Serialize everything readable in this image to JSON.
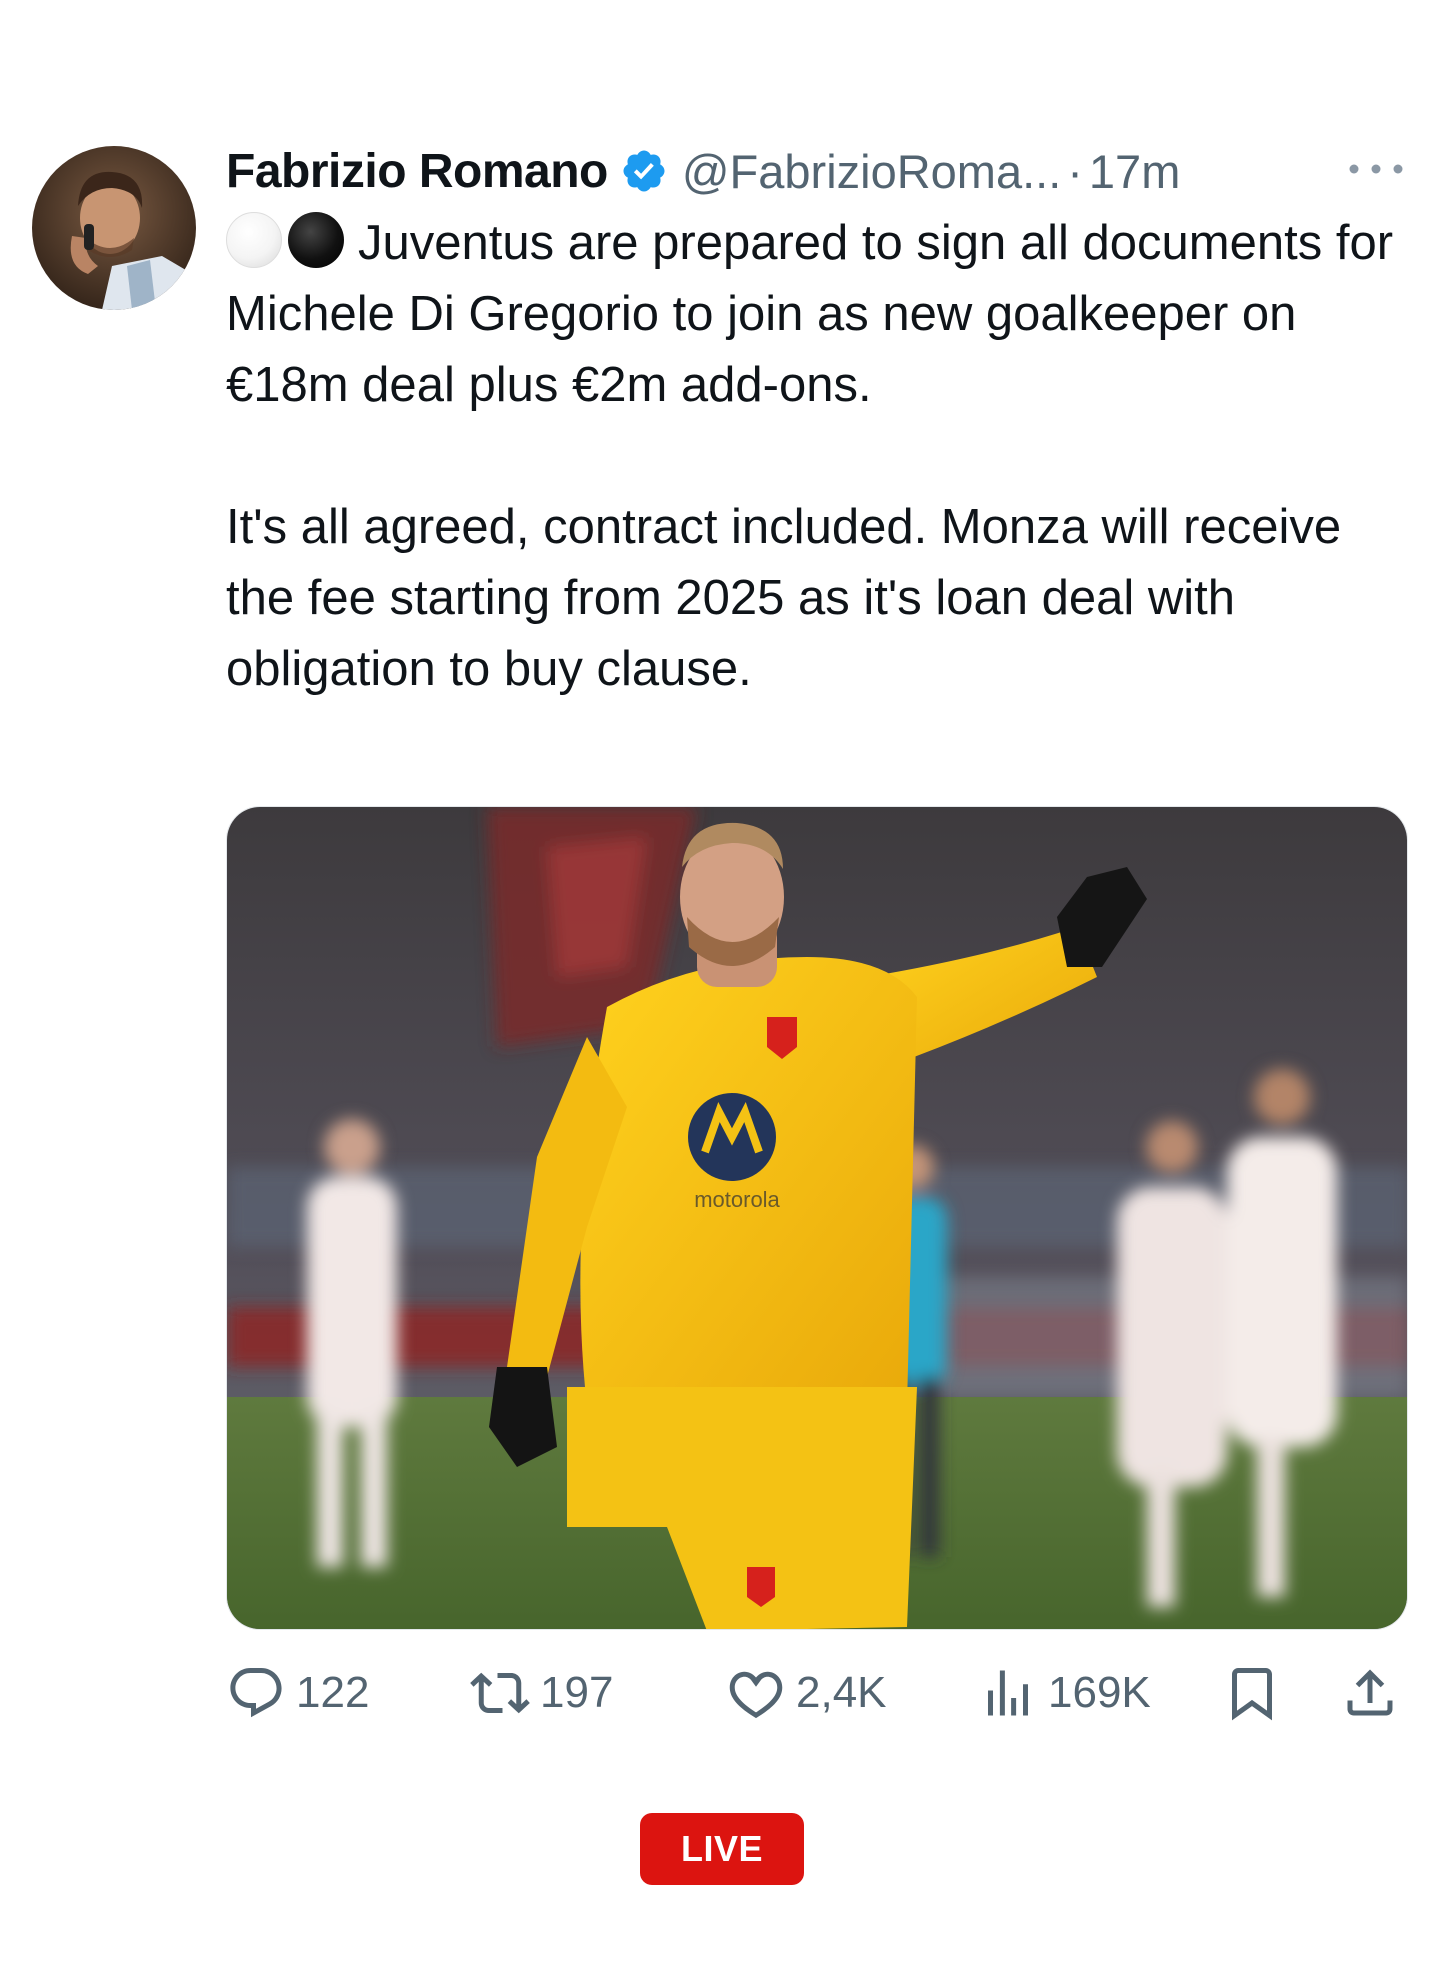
{
  "author": {
    "display_name": "Fabrizio Romano",
    "handle": "@FabrizioRoma...",
    "separator": "·",
    "time": "17m",
    "verified": true
  },
  "body": {
    "emoji": [
      "white-circle",
      "black-circle"
    ],
    "paragraph1": "Juventus are prepared to sign all documents for Michele Di Gregorio to join as new goalkeeper on €18m deal plus €2m add-ons.",
    "paragraph2": "It's all agreed, contract included. Monza will receive the fee starting from 2025 as it's loan deal with obligation to buy clause."
  },
  "media": {
    "shirt_sponsor": "motorola"
  },
  "actions": {
    "replies": "122",
    "reposts": "197",
    "likes": "2,4K",
    "views": "169K"
  },
  "live_badge": "LIVE",
  "colors": {
    "text": "#0f1419",
    "secondary": "#536471",
    "verified": "#1d9bf0",
    "live": "#dc1410"
  }
}
